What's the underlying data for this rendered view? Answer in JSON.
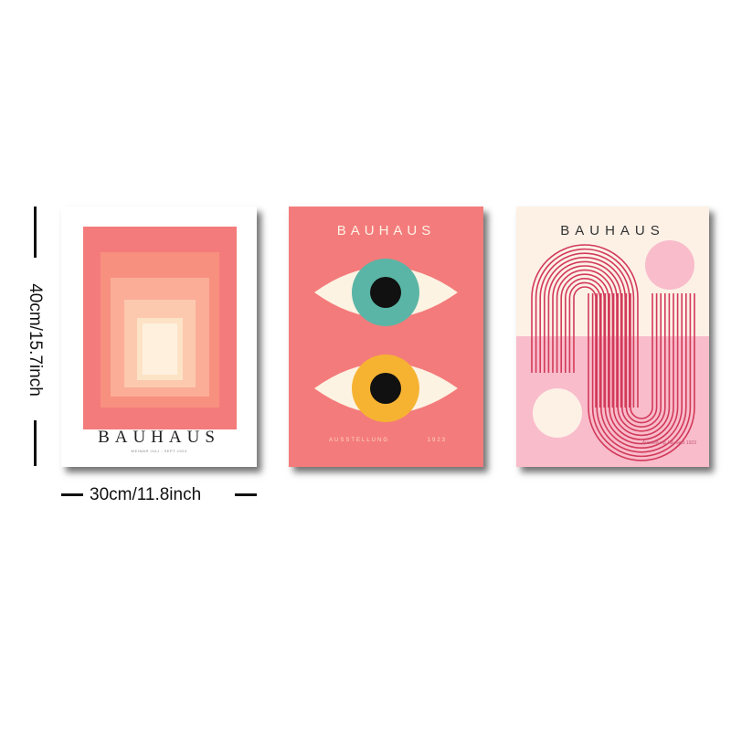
{
  "dimensions": {
    "height_label": "40cm/15.7inch",
    "width_label": "30cm/11.8inch"
  },
  "poster1": {
    "title": "BAUHAUS",
    "subtitle": "WEIMAR JULI - SEPT 1923",
    "colors": [
      "#f47b7b",
      "#f8907f",
      "#fbad98",
      "#fcc9af",
      "#fde3c6",
      "#fef0dc"
    ]
  },
  "poster2": {
    "title": "BAUHAUS",
    "footer_left": "AUSSTELLUNG",
    "footer_right": "1923",
    "colors": {
      "background": "#f47b7b",
      "eye_white": "#fdf3e3",
      "iris_top": "#5ab5a6",
      "iris_bottom": "#f6b332",
      "pupil": "#111111"
    }
  },
  "poster3": {
    "title": "BAUHAUS",
    "footer": "Ausstellung Juli-Sept 1923",
    "colors": {
      "top": "#fdf1e6",
      "bottom": "#f9bccb",
      "arch": "#d23a5a",
      "circle_pink": "#f9bccb",
      "circle_cream": "#fdf1e6"
    }
  }
}
